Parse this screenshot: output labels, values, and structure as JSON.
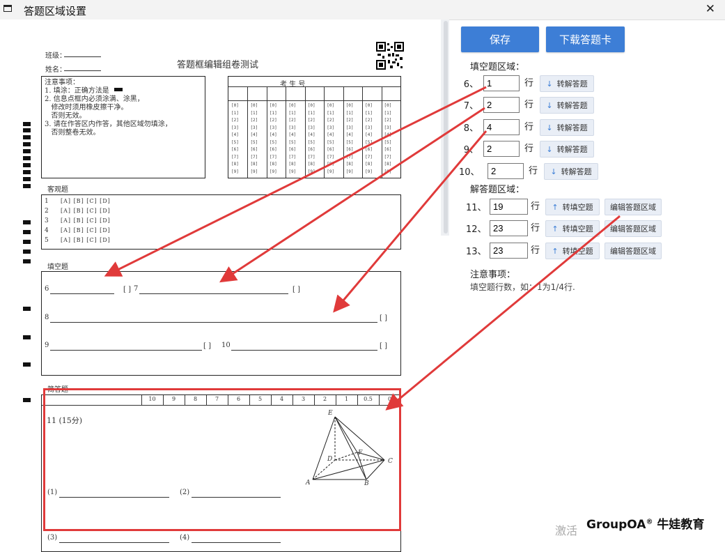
{
  "window": {
    "title": "答题区域设置",
    "close_glyph": "✕"
  },
  "actions": {
    "save": "保存",
    "download": "下载答题卡"
  },
  "fill_section": {
    "label": "填空题区域：",
    "rows": [
      {
        "num": "6、",
        "value": "1",
        "unit": "行",
        "btn": "转解答题"
      },
      {
        "num": "7、",
        "value": "2",
        "unit": "行",
        "btn": "转解答题"
      },
      {
        "num": "8、",
        "value": "4",
        "unit": "行",
        "btn": "转解答题"
      },
      {
        "num": "9、",
        "value": "2",
        "unit": "行",
        "btn": "转解答题"
      },
      {
        "num": "10、",
        "value": "2",
        "unit": "行",
        "btn": "转解答题"
      }
    ]
  },
  "answer_section": {
    "label": "解答题区域：",
    "rows": [
      {
        "num": "11、",
        "value": "19",
        "unit": "行",
        "btn": "转填空题",
        "edit": "编辑答题区域"
      },
      {
        "num": "12、",
        "value": "23",
        "unit": "行",
        "btn": "转填空题",
        "edit": "编辑答题区域"
      },
      {
        "num": "13、",
        "value": "23",
        "unit": "行",
        "btn": "转填空题",
        "edit": "编辑答题区域"
      }
    ]
  },
  "notes": {
    "title": "注意事项：",
    "text": "填空题行数，如：1为1/4行."
  },
  "sheet": {
    "class_label": "班级：",
    "name_label": "姓名：",
    "exam_title": "答题框编辑组卷测试",
    "notice_lines": [
      "注意事项：",
      "1. 填涂：正确方法是",
      "2. 信息点框内必须涂满、涂黑，",
      "   修改时须用橡皮擦干净。",
      "   否则无效。",
      "3. 请在作答区内作答，其他区域勿填涂，",
      "   否则整卷无效。"
    ],
    "student_no_label": "考  生  号",
    "objective_title": "客观题",
    "objective_rows": [
      "1",
      "2",
      "3",
      "4",
      "5"
    ],
    "objective_options": "[A] [B] [C] [D]",
    "fill_title": "填空题",
    "fill_items": [
      "6",
      "7",
      "8",
      "9",
      "10"
    ],
    "bracket": "[  ]",
    "essay_title": "简答题",
    "score_cells": [
      "10",
      "9",
      "8",
      "7",
      "6",
      "5",
      "4",
      "3",
      "2",
      "1",
      "0.5",
      "0"
    ],
    "q11_title": "11 (15分)",
    "q11_parts": [
      "(1)",
      "(2)",
      "(3)",
      "(4)"
    ],
    "figure_labels": [
      "E",
      "F",
      "D",
      "A",
      "B",
      "C"
    ]
  },
  "overlay": {
    "watermark": "激活",
    "brand": "GroupOA",
    "brand_mark": "®",
    "brand_cn": "牛娃教育"
  },
  "colors": {
    "primary": "#3d7ed6",
    "annotation": "#e03a3a"
  }
}
